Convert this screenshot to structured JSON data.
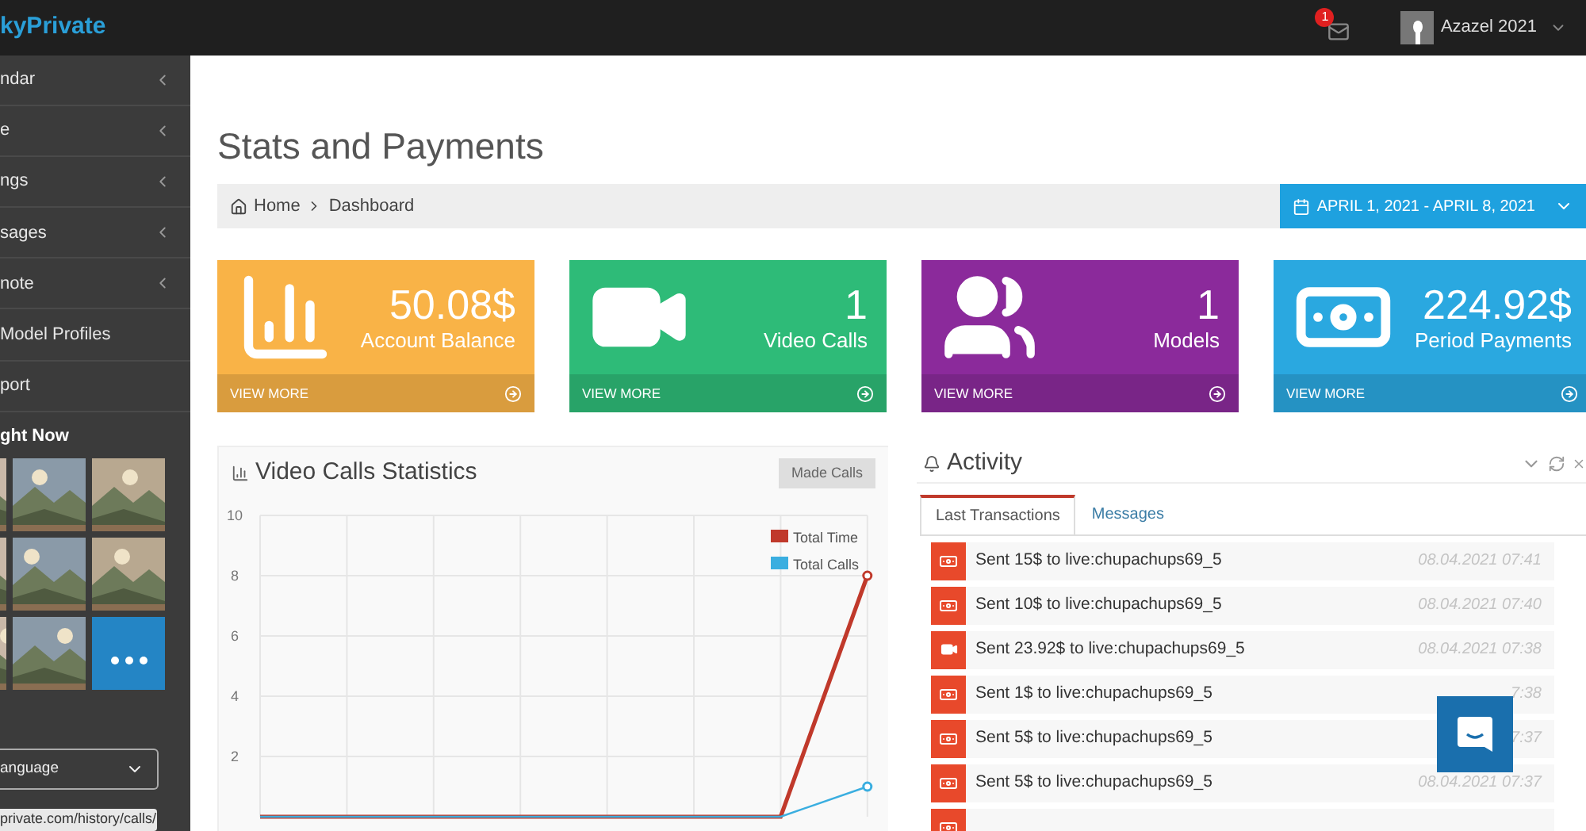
{
  "brand": "kyPrivate",
  "top_bar": {
    "notifications": "1",
    "user": "Azazel 2021"
  },
  "sidebar": {
    "items": [
      {
        "label": "ndar",
        "expandable": true
      },
      {
        "label": "e",
        "expandable": true
      },
      {
        "label": "ngs",
        "expandable": true
      },
      {
        "label": "sages",
        "expandable": true
      },
      {
        "label": "note",
        "expandable": true
      },
      {
        "label": "Model Profiles",
        "expandable": false
      },
      {
        "label": "port",
        "expandable": false
      }
    ],
    "section_title": "ght Now",
    "thumbnails": [
      {
        "kind": "picture"
      },
      {
        "kind": "picture"
      },
      {
        "kind": "picture"
      },
      {
        "kind": "picture"
      },
      {
        "kind": "picture"
      },
      {
        "kind": "picture"
      },
      {
        "kind": "picture"
      },
      {
        "kind": "picture"
      },
      {
        "kind": "more"
      }
    ],
    "language": "anguage",
    "status_url": "private.com/history/calls/"
  },
  "page_title": "Stats and Payments",
  "breadcrumb": [
    "Home",
    "Dashboard"
  ],
  "date_range": "APRIL 1, 2021 - APRIL 8, 2021",
  "stats": [
    {
      "kind": "chart",
      "value": "50.08$",
      "label": "Account Balance",
      "link": "VIEW MORE",
      "color": "#f9b347"
    },
    {
      "kind": "video",
      "value": "1",
      "label": "Video Calls",
      "link": "VIEW MORE",
      "color": "#2ebb78"
    },
    {
      "kind": "users",
      "value": "1",
      "label": "Models",
      "link": "VIEW MORE",
      "color": "#8b2a9b"
    },
    {
      "kind": "money",
      "value": "224.92$",
      "label": "Period Payments",
      "link": "VIEW MORE",
      "color": "#2aa8e0"
    }
  ],
  "chart_panel": {
    "title": "Video Calls Statistics",
    "button": "Made Calls",
    "chart_data": {
      "type": "line",
      "ylim": [
        0,
        10
      ],
      "yticks": [
        2,
        4,
        6,
        8,
        10
      ],
      "grid": true,
      "legend": "top-right",
      "series": [
        {
          "name": "Total Time",
          "color": "#c0392b",
          "values": [
            0,
            0,
            0,
            0,
            0,
            0,
            0,
            8
          ]
        },
        {
          "name": "Total Calls",
          "color": "#3aaee0",
          "values": [
            0,
            0,
            0,
            0,
            0,
            0,
            0,
            1
          ]
        }
      ]
    }
  },
  "activity": {
    "title": "Activity",
    "tabs": [
      {
        "label": "Last Transactions",
        "selected": true
      },
      {
        "label": "Messages",
        "selected": false
      }
    ],
    "rows": [
      {
        "kind": "money",
        "text": "Sent 15$ to live:chupachups69_5",
        "time": "08.04.2021 07:41"
      },
      {
        "kind": "money",
        "text": "Sent 10$ to live:chupachups69_5",
        "time": "08.04.2021 07:40"
      },
      {
        "kind": "video",
        "text": "Sent 23.92$ to live:chupachups69_5",
        "time": "08.04.2021 07:38"
      },
      {
        "kind": "money",
        "text": "Sent 1$ to live:chupachups69_5",
        "time": "7:38"
      },
      {
        "kind": "money",
        "text": "Sent 5$ to live:chupachups69_5",
        "time": "7:37"
      },
      {
        "kind": "money",
        "text": "Sent 5$ to live:chupachups69_5",
        "time": "08.04.2021 07:37"
      },
      {
        "kind": "money"
      }
    ]
  }
}
